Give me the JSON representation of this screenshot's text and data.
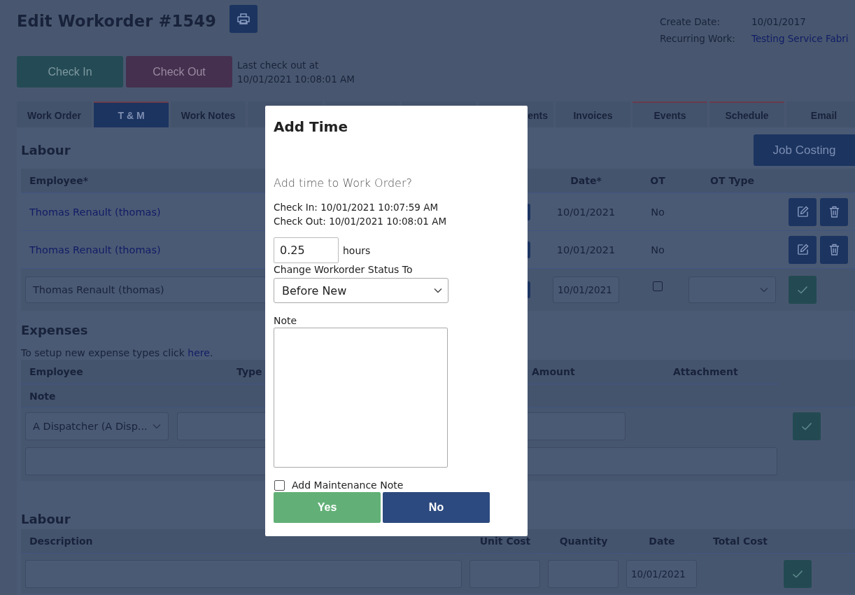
{
  "header": {
    "title": "Edit Workorder #1549",
    "create_date_label": "Create Date:",
    "create_date": "10/01/2017",
    "recurring_label": "Recurring Work:",
    "recurring_link": "Testing Service Fabri"
  },
  "checkin": {
    "check_in": "Check In",
    "check_out": "Check Out",
    "last_label": "Last check out at",
    "last_time": "10/01/2021 10:08:01 AM"
  },
  "tabs": [
    {
      "label": "Work Order",
      "selected": false,
      "accent": false
    },
    {
      "label": "T & M",
      "selected": true,
      "accent": true
    },
    {
      "label": "Work Notes",
      "selected": false,
      "accent": false
    },
    {
      "label": "ents",
      "selected": false,
      "accent": false
    },
    {
      "label": "Invoices",
      "selected": false,
      "accent": false
    },
    {
      "label": "Events",
      "selected": false,
      "accent": true
    },
    {
      "label": "Schedule",
      "selected": false,
      "accent": true
    },
    {
      "label": "Email",
      "selected": false,
      "accent": false
    }
  ],
  "labour": {
    "title": "Labour",
    "job_costing": "Job Costing",
    "columns": [
      "Employee*",
      "Date*",
      "OT",
      "OT Type"
    ],
    "rows": [
      {
        "employee": "Thomas Renault (thomas)",
        "date": "10/01/2021",
        "ot": "No"
      },
      {
        "employee": "Thomas Renault (thomas)",
        "date": "10/01/2021",
        "ot": "No"
      }
    ],
    "new_row": {
      "employee": "Thomas Renault (thomas)",
      "date": "10/01/2021",
      "ot_checked": false
    }
  },
  "expenses": {
    "title": "Expenses",
    "hint_before": "To setup new expense types click ",
    "hint_link": "here",
    "hint_after": ".",
    "columns": [
      "Employee",
      "Type",
      "Amount",
      "Attachment"
    ],
    "note_column": "Note",
    "new_row": {
      "employee": "A Dispatcher (A Disp..."
    }
  },
  "labour_items": {
    "title": "Labour",
    "columns": [
      "Description",
      "Unit Cost",
      "Quantity",
      "Date",
      "Total Cost"
    ],
    "new_row": {
      "date": "10/01/2021"
    }
  },
  "dialog": {
    "title": "Add Time",
    "question": "Add time to Work Order?",
    "check_in": "Check In: 10/01/2021 10:07:59 AM",
    "check_out": "Check Out: 10/01/2021 10:08:01 AM",
    "hours_value": "0.25",
    "hours_unit": "hours",
    "status_label": "Change Workorder Status To",
    "status_value": "Before New",
    "note_label": "Note",
    "maintenance_label": "Add Maintenance Note",
    "maintenance_checked": false,
    "yes": "Yes",
    "no": "No"
  }
}
